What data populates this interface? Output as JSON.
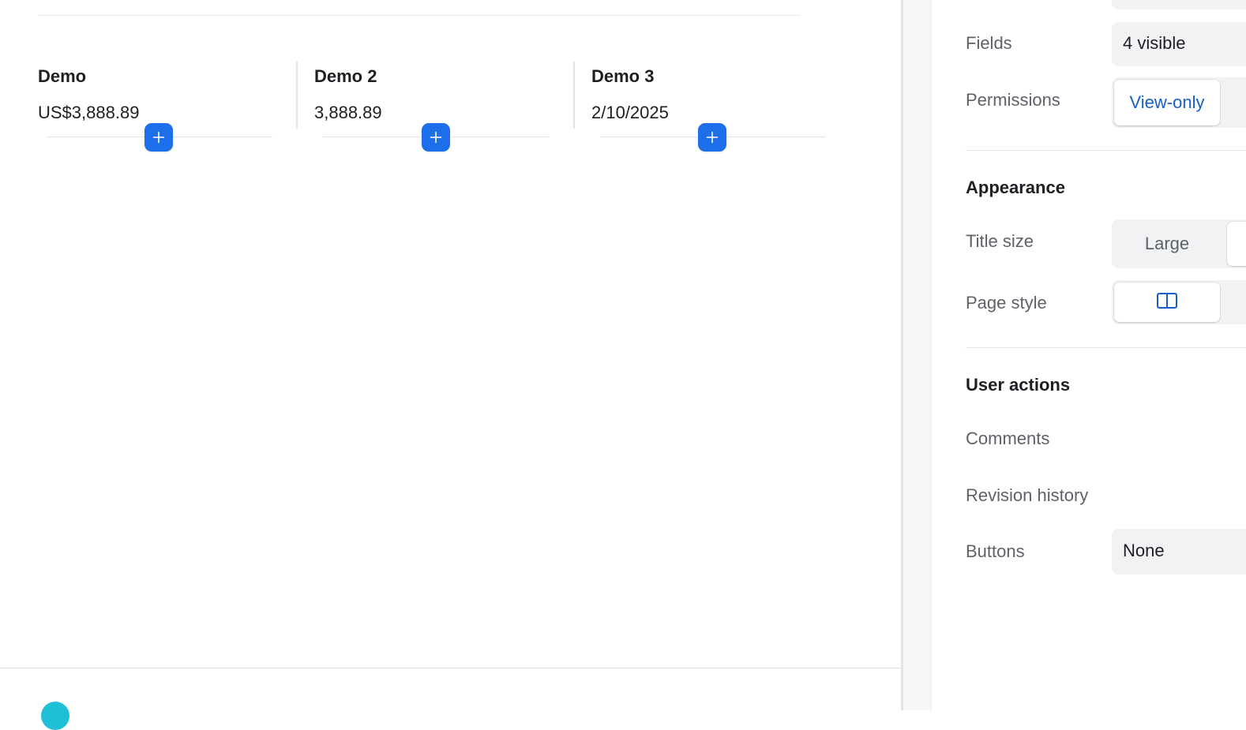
{
  "canvas": {
    "fields": [
      {
        "label": "Demo",
        "value": "US$3,888.89"
      },
      {
        "label": "Demo 2",
        "value": "3,888.89"
      },
      {
        "label": "Demo 3",
        "value": "2/10/2025"
      }
    ],
    "add_button_icon": "plus-icon"
  },
  "panel": {
    "fields": {
      "label": "Fields",
      "value": "4 visible"
    },
    "permissions": {
      "label": "Permissions",
      "value": "View-only"
    },
    "appearance": {
      "title": "Appearance",
      "title_size": {
        "label": "Title size",
        "value": "Large"
      },
      "page_style": {
        "label": "Page style",
        "icon": "split-layout-icon"
      }
    },
    "user_actions": {
      "title": "User actions",
      "comments": {
        "label": "Comments"
      },
      "revision_history": {
        "label": "Revision history"
      },
      "buttons": {
        "label": "Buttons",
        "value": "None"
      }
    }
  },
  "colors": {
    "accent": "#1c6fe8",
    "link_blue": "#1560c8",
    "control_bg": "#f1f2f4",
    "footer_dot": "#20bfd8"
  }
}
